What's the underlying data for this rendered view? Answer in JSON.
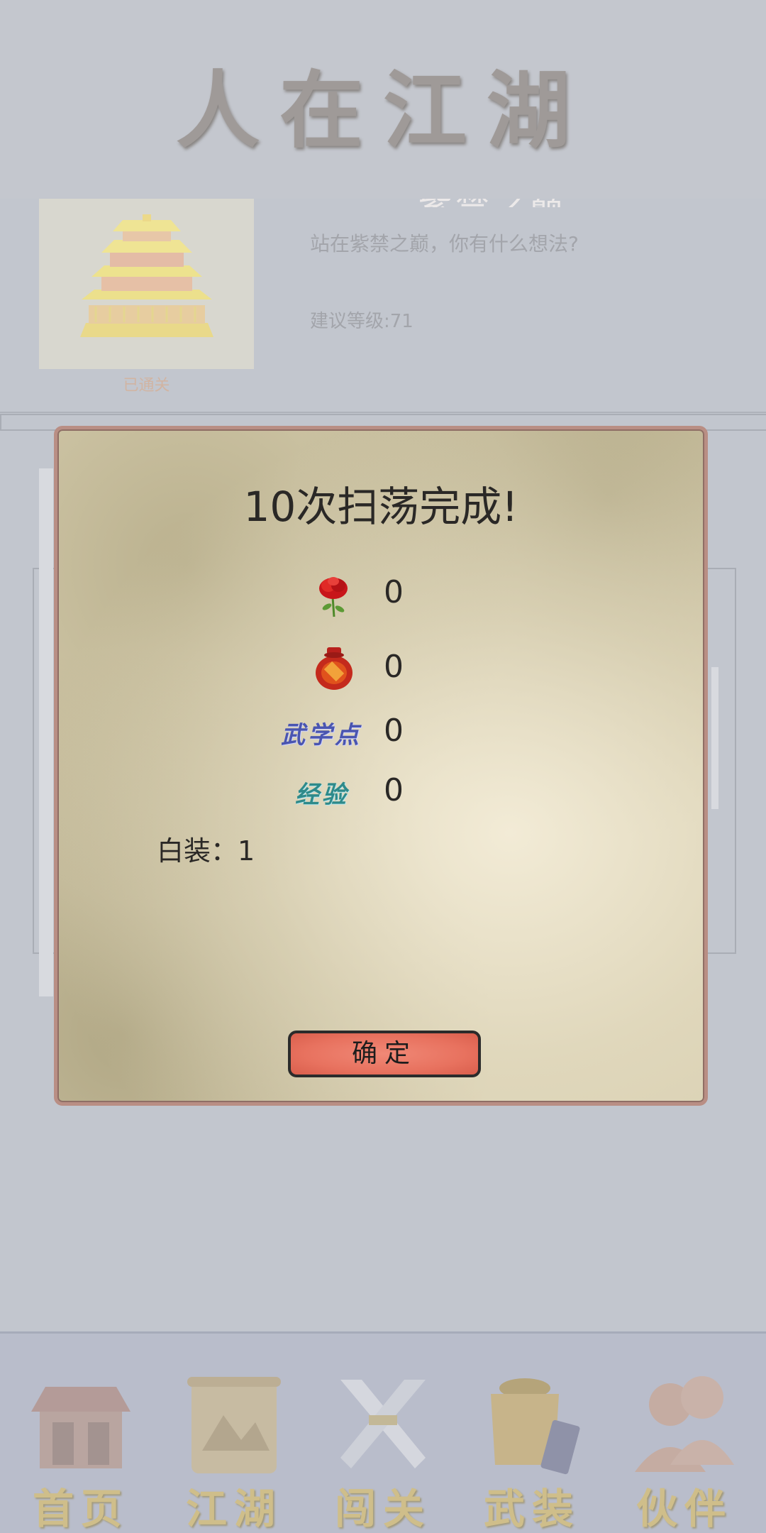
{
  "header": {
    "title": "人在江湖"
  },
  "stage": {
    "name": "紫禁之巅",
    "description": "站在紫禁之巅，你有什么想法?",
    "level": "建议等级:71",
    "status": "已通关"
  },
  "modal": {
    "title": "10次扫荡完成!",
    "rewards": [
      {
        "icon": "rose-icon",
        "value": "0"
      },
      {
        "icon": "wine-jar-icon",
        "value": "0"
      },
      {
        "icon": "martial-points-icon",
        "icon_text": "武学点",
        "value": "0"
      },
      {
        "icon": "experience-icon",
        "icon_text": "经验",
        "value": "0"
      }
    ],
    "equipment": "白装：1",
    "confirm_label": "确定"
  },
  "nav": {
    "items": [
      {
        "label": "首页",
        "icon": "house-icon"
      },
      {
        "label": "江湖",
        "icon": "scroll-icon"
      },
      {
        "label": "闯关",
        "icon": "crossed-swords-icon"
      },
      {
        "label": "武装",
        "icon": "armor-icon"
      },
      {
        "label": "伙伴",
        "icon": "companions-icon"
      }
    ]
  }
}
